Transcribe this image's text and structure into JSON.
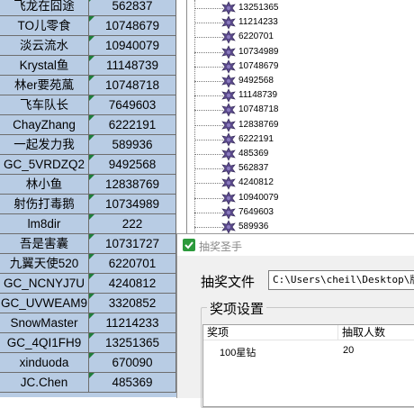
{
  "sheet": {
    "rows": [
      {
        "name": "飞龙在囧途",
        "id": "562837"
      },
      {
        "name": "TO儿零食",
        "id": "10748679"
      },
      {
        "name": "淡云流水",
        "id": "10940079"
      },
      {
        "name": "Krystal鱼",
        "id": "11148739"
      },
      {
        "name": "林er要苑葻",
        "id": "10748718"
      },
      {
        "name": "飞车队长",
        "id": "7649603"
      },
      {
        "name": "ChayZhang",
        "id": "6222191"
      },
      {
        "name": "一起发力我",
        "id": "589936"
      },
      {
        "name": "GC_5VRDZQ2",
        "id": "9492568"
      },
      {
        "name": "林小鱼",
        "id": "12838769"
      },
      {
        "name": "射伤打毒鹅",
        "id": "10734989"
      },
      {
        "name": "lm8dir",
        "id": "222"
      },
      {
        "name": "吾是害囊",
        "id": "10731727"
      },
      {
        "name": "九翼天使520",
        "id": "6220701"
      },
      {
        "name": "GC_NCNYJ7U",
        "id": "4240812"
      },
      {
        "name": "GC_UVWEAM9",
        "id": "3320852"
      },
      {
        "name": "SnowMaster",
        "id": "11214233"
      },
      {
        "name": "GC_4QI1FH9",
        "id": "13251365"
      },
      {
        "name": "xinduoda",
        "id": "670090"
      },
      {
        "name": "JC.Chen",
        "id": "485369"
      }
    ]
  },
  "tree": {
    "items": [
      "13251365",
      "11214233",
      "6220701",
      "10734989",
      "10748679",
      "9492568",
      "11148739",
      "10748718",
      "12838769",
      "6222191",
      "485369",
      "562837",
      "4240812",
      "10940079",
      "7649603",
      "589936"
    ]
  },
  "dialog": {
    "title": "抽奖圣手",
    "file_label": "抽奖文件",
    "file_path": "C:\\Users\\cheil\\Desktop\\版块",
    "group_label": "奖项设置",
    "columns": [
      "奖项",
      "抽取人数"
    ],
    "prizes": [
      {
        "prize": "100星钻",
        "count": "20"
      }
    ]
  },
  "colors": {
    "sheet_bg": "#b8cce4",
    "corner_marker": "#1f7d3a",
    "tree_icon": "#5b4a8c"
  }
}
